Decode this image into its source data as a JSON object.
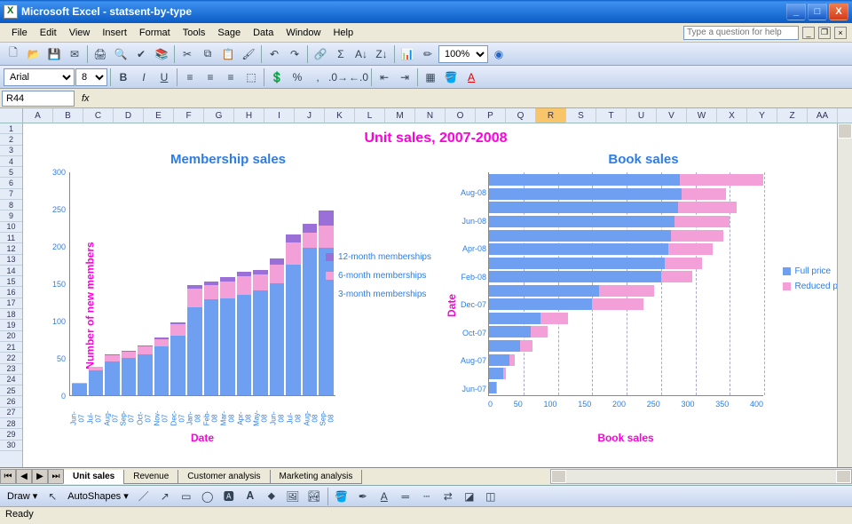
{
  "titlebar": {
    "app": "Microsoft Excel",
    "doc": "statsent-by-type"
  },
  "menu": [
    "File",
    "Edit",
    "View",
    "Insert",
    "Format",
    "Tools",
    "Sage",
    "Data",
    "Window",
    "Help"
  ],
  "help_placeholder": "Type a question for help",
  "namebox": "R44",
  "font": {
    "name": "Arial",
    "size": "8"
  },
  "zoom": "100%",
  "columns": [
    "A",
    "B",
    "C",
    "D",
    "E",
    "F",
    "G",
    "H",
    "I",
    "J",
    "K",
    "L",
    "M",
    "N",
    "O",
    "P",
    "Q",
    "R",
    "S",
    "T",
    "U",
    "V",
    "W",
    "X",
    "Y",
    "Z",
    "AA"
  ],
  "active_col": "R",
  "rows": 30,
  "tabs": [
    "Unit sales",
    "Revenue",
    "Customer analysis",
    "Marketing analysis"
  ],
  "active_tab": 0,
  "status": "Ready",
  "draw_label": "Draw",
  "autoshapes_label": "AutoShapes",
  "main_title": "Unit sales, 2007-2008",
  "chart_data": [
    {
      "type": "bar",
      "orientation": "vertical-stacked",
      "title": "Membership sales",
      "xlabel": "Date",
      "ylabel": "Number of new members",
      "ylim": [
        0,
        300
      ],
      "yticks": [
        0,
        50,
        100,
        150,
        200,
        250,
        300
      ],
      "categories": [
        "Jun-07",
        "Jul-07",
        "Aug-07",
        "Sep-07",
        "Oct-07",
        "Nov-07",
        "Dec-07",
        "Jan-08",
        "Feb-08",
        "Mar-08",
        "Apr-08",
        "May-08",
        "Jun-08",
        "Jul-08",
        "Aug-08",
        "Sep-08"
      ],
      "series": [
        {
          "name": "3-month memberships",
          "color": "#6f9ff0",
          "values": [
            15,
            33,
            45,
            50,
            55,
            65,
            80,
            118,
            128,
            130,
            135,
            140,
            150,
            175,
            198,
            198
          ]
        },
        {
          "name": "6-month memberships",
          "color": "#f4a0d8",
          "values": [
            2,
            5,
            8,
            8,
            10,
            10,
            15,
            25,
            20,
            22,
            25,
            22,
            25,
            30,
            20,
            30
          ]
        },
        {
          "name": "12-month memberships",
          "color": "#9a6fd8",
          "values": [
            0,
            0,
            2,
            2,
            2,
            3,
            3,
            5,
            5,
            6,
            6,
            6,
            8,
            10,
            12,
            20
          ]
        }
      ],
      "legend": [
        "12-month memberships",
        "6-month memberships",
        "3-month memberships"
      ]
    },
    {
      "type": "bar",
      "orientation": "horizontal-stacked",
      "title": "Book sales",
      "xlabel": "Book sales",
      "ylabel": "Date",
      "xlim": [
        0,
        400
      ],
      "xticks": [
        0,
        50,
        100,
        150,
        200,
        250,
        300,
        350,
        400
      ],
      "categories": [
        "Jun-07",
        "Jul-07",
        "Aug-07",
        "Sep-07",
        "Oct-07",
        "Nov-07",
        "Dec-07",
        "Jan-08",
        "Feb-08",
        "Mar-08",
        "Apr-08",
        "May-08",
        "Jun-08",
        "Jul-08",
        "Aug-08",
        "Sep-08"
      ],
      "ytick_labels": [
        "Jun-07",
        "",
        "Aug-07",
        "",
        "Oct-07",
        "",
        "Dec-07",
        "",
        "Feb-08",
        "",
        "Apr-08",
        "",
        "Jun-08",
        "",
        "Aug-08",
        ""
      ],
      "series": [
        {
          "name": "Full price",
          "color": "#6f9ff0",
          "values": [
            10,
            20,
            30,
            45,
            60,
            75,
            150,
            160,
            250,
            255,
            260,
            265,
            270,
            275,
            280,
            285
          ]
        },
        {
          "name": "Reduced price",
          "color": "#f4a0d8",
          "values": [
            2,
            5,
            8,
            18,
            25,
            40,
            75,
            80,
            45,
            55,
            65,
            75,
            80,
            85,
            65,
            125
          ]
        }
      ],
      "legend": [
        "Full price",
        "Reduced price"
      ]
    }
  ]
}
